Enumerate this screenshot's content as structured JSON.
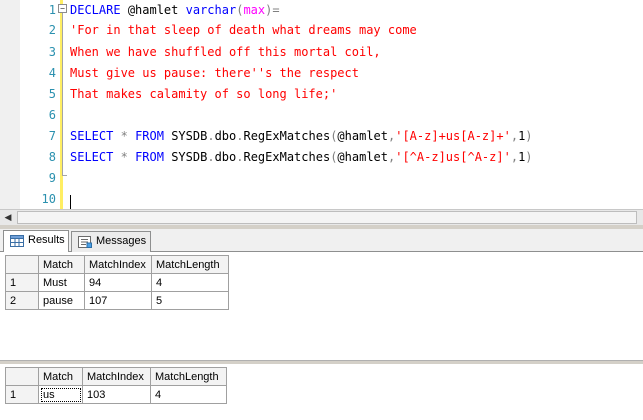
{
  "editor": {
    "lines": [
      {
        "n": "1",
        "parts": [
          {
            "t": "DECLARE",
            "c": "kw"
          },
          {
            "t": " ",
            "c": "id"
          },
          {
            "t": "@hamlet",
            "c": "id"
          },
          {
            "t": " ",
            "c": "id"
          },
          {
            "t": "varchar",
            "c": "kw"
          },
          {
            "t": "(",
            "c": "op"
          },
          {
            "t": "max",
            "c": "fn"
          },
          {
            "t": ")",
            "c": "op"
          },
          {
            "t": "=",
            "c": "op"
          }
        ]
      },
      {
        "n": "2",
        "parts": [
          {
            "t": "'For in that sleep of death what dreams may come",
            "c": "str"
          }
        ]
      },
      {
        "n": "3",
        "parts": [
          {
            "t": "When we have shuffled off this mortal coil,",
            "c": "str"
          }
        ]
      },
      {
        "n": "4",
        "parts": [
          {
            "t": "Must give us pause: there''s the respect",
            "c": "str"
          }
        ]
      },
      {
        "n": "5",
        "parts": [
          {
            "t": "That makes calamity of so long life;'",
            "c": "str"
          }
        ]
      },
      {
        "n": "6",
        "parts": []
      },
      {
        "n": "7",
        "parts": [
          {
            "t": "SELECT",
            "c": "kw"
          },
          {
            "t": " ",
            "c": "id"
          },
          {
            "t": "*",
            "c": "op"
          },
          {
            "t": " ",
            "c": "id"
          },
          {
            "t": "FROM",
            "c": "kw"
          },
          {
            "t": " SYSDB",
            "c": "id"
          },
          {
            "t": ".",
            "c": "op"
          },
          {
            "t": "dbo",
            "c": "id"
          },
          {
            "t": ".",
            "c": "op"
          },
          {
            "t": "RegExMatches",
            "c": "id"
          },
          {
            "t": "(",
            "c": "op"
          },
          {
            "t": "@hamlet",
            "c": "id"
          },
          {
            "t": ",",
            "c": "op"
          },
          {
            "t": "'[A-z]+us[A-z]+'",
            "c": "str"
          },
          {
            "t": ",",
            "c": "op"
          },
          {
            "t": "1",
            "c": "id"
          },
          {
            "t": ")",
            "c": "op"
          }
        ]
      },
      {
        "n": "8",
        "parts": [
          {
            "t": "SELECT",
            "c": "kw"
          },
          {
            "t": " ",
            "c": "id"
          },
          {
            "t": "*",
            "c": "op"
          },
          {
            "t": " ",
            "c": "id"
          },
          {
            "t": "FROM",
            "c": "kw"
          },
          {
            "t": " SYSDB",
            "c": "id"
          },
          {
            "t": ".",
            "c": "op"
          },
          {
            "t": "dbo",
            "c": "id"
          },
          {
            "t": ".",
            "c": "op"
          },
          {
            "t": "RegExMatches",
            "c": "id"
          },
          {
            "t": "(",
            "c": "op"
          },
          {
            "t": "@hamlet",
            "c": "id"
          },
          {
            "t": ",",
            "c": "op"
          },
          {
            "t": "'[^A-z]us[^A-z]'",
            "c": "str"
          },
          {
            "t": ",",
            "c": "op"
          },
          {
            "t": "1",
            "c": "id"
          },
          {
            "t": ")",
            "c": "op"
          }
        ]
      },
      {
        "n": "9",
        "parts": []
      },
      {
        "n": "10",
        "parts": []
      }
    ]
  },
  "tabs": {
    "results_label": "Results",
    "messages_label": "Messages"
  },
  "grid1": {
    "columns": [
      "Match",
      "MatchIndex",
      "MatchLength"
    ],
    "rows": [
      {
        "num": "1",
        "cells": [
          "Must",
          "94",
          "4"
        ]
      },
      {
        "num": "2",
        "cells": [
          "pause",
          "107",
          "5"
        ]
      }
    ]
  },
  "grid2": {
    "columns": [
      "Match",
      "MatchIndex",
      "MatchLength"
    ],
    "rows": [
      {
        "num": "1",
        "cells": [
          "us",
          "103",
          "4"
        ]
      }
    ]
  },
  "colors": {
    "keyword": "#0000ff",
    "string": "#ff0000",
    "function": "#ff00ff",
    "operator": "#808080",
    "line_number": "#2b91af",
    "change_bar": "#ffee62"
  }
}
